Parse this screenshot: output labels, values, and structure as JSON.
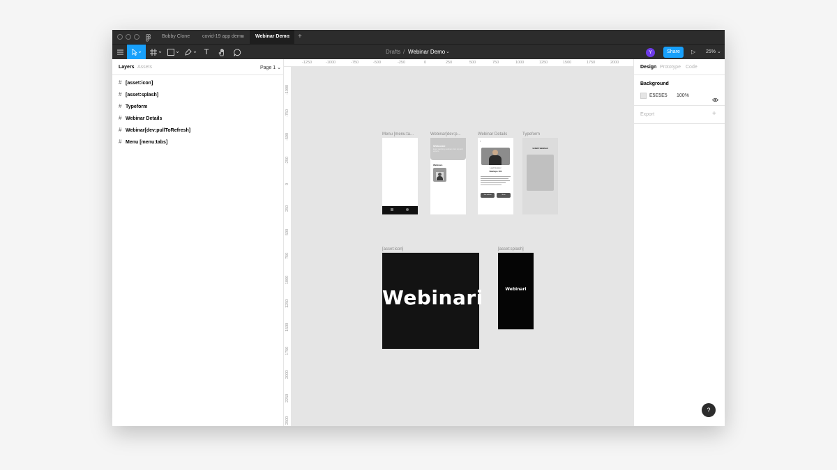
{
  "titlebar": {
    "tabs": [
      {
        "label": "Bobby Clone",
        "active": false
      },
      {
        "label": "covid-19 app demo",
        "active": false
      },
      {
        "label": "Webinar Demo",
        "active": true
      }
    ],
    "close_glyph": "×",
    "new_tab_glyph": "+"
  },
  "toolbar": {
    "menu_icon": "hamburger-icon",
    "move_tool_icon": "cursor-icon",
    "frame_tool_icon": "hash-icon",
    "shape_tool_icon": "rectangle-icon",
    "pen_tool_icon": "pen-icon",
    "text_tool": "T",
    "hand_tool_icon": "hand-icon",
    "comment_tool_icon": "comment-icon",
    "breadcrumb_parent": "Drafts",
    "breadcrumb_separator": "/",
    "file_name": "Webinar Demo",
    "avatar_initial": "Y",
    "share_label": "Share",
    "present_glyph": "▷",
    "zoom": "25%",
    "accent": "#18a0fb"
  },
  "left_panel": {
    "tabs": [
      "Layers",
      "Assets"
    ],
    "page": "Page 1",
    "layers": [
      "[asset:icon]",
      "[asset:splash]",
      "Typeform",
      "Webinar Details",
      "Webinar[dev:pullToRefresh]",
      "Menu [menu:tabs]"
    ]
  },
  "rulers": {
    "horizontal": [
      "-1250",
      "-1000",
      "-750",
      "-500",
      "-250",
      "0",
      "250",
      "500",
      "750",
      "1000",
      "1250",
      "1500",
      "1750",
      "2000"
    ],
    "vertical": [
      "-1000",
      "-750",
      "-500",
      "-250",
      "0",
      "250",
      "500",
      "750",
      "1000",
      "1250",
      "1500",
      "1750",
      "2000",
      "2250",
      "2500"
    ]
  },
  "canvas": {
    "frame_labels": {
      "menu": "Menu [menu:ta...",
      "webinar": "Webinar[dev:p...",
      "details": "Webinar Details",
      "typeform": "Typeform",
      "icon": "[asset:icon]",
      "splash": "[asset:splash]"
    },
    "welcome_title": "Welcome",
    "welcome_sub": "Enjoy watching webinars from top tech experts.",
    "webinars_heading": "Webinars",
    "speaker_role": "Lead Designer",
    "speaker_name": "Startups 101",
    "typeform_title": "SUBMIT WEBINAR",
    "details_btn_1": "Join webinar",
    "details_btn_2": "Share",
    "icon_logo": "Webinari",
    "splash_logo": "Webinari"
  },
  "right_panel": {
    "tabs": [
      "Design",
      "Prototype",
      "Code"
    ],
    "background_heading": "Background",
    "background_hex": "E5E5E5",
    "background_opacity": "100%",
    "background_color": "#e5e5e5",
    "eye_icon": "eye-icon",
    "export_heading": "Export",
    "add_glyph": "+"
  },
  "help_glyph": "?"
}
